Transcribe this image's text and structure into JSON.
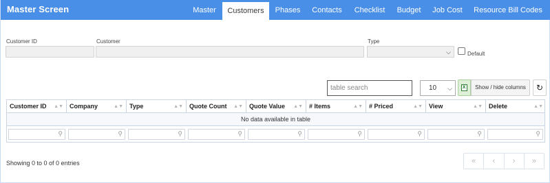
{
  "header": {
    "title": "Master Screen",
    "tabs": [
      {
        "label": "Master",
        "active": false
      },
      {
        "label": "Customers",
        "active": true
      },
      {
        "label": "Phases",
        "active": false
      },
      {
        "label": "Contacts",
        "active": false
      },
      {
        "label": "Checklist",
        "active": false
      },
      {
        "label": "Budget",
        "active": false
      },
      {
        "label": "Job Cost",
        "active": false
      },
      {
        "label": "Resource Bill Codes",
        "active": false
      }
    ]
  },
  "form": {
    "customer_id_label": "Customer ID",
    "customer_id_value": "",
    "customer_label": "Customer",
    "customer_value": "",
    "type_label": "Type",
    "type_value": "",
    "default_label": "Default",
    "default_checked": false
  },
  "table_controls": {
    "search_placeholder": "table search",
    "page_size": "10",
    "column_toggle_label": "Show / hide columns"
  },
  "table": {
    "columns": [
      "Customer ID",
      "Company",
      "Type",
      "Quote Count",
      "Quote Value",
      "# Items",
      "# Priced",
      "View",
      "Delete"
    ],
    "empty_message": "No data available in table"
  },
  "footer": {
    "info": "Showing 0 to 0 of 0 entries",
    "pager": [
      "«",
      "‹",
      "›",
      "»"
    ]
  },
  "colors": {
    "header_bg": "#4a8fe7",
    "active_tab_bg": "#ffffff",
    "excel_green": "#2e7d32"
  }
}
